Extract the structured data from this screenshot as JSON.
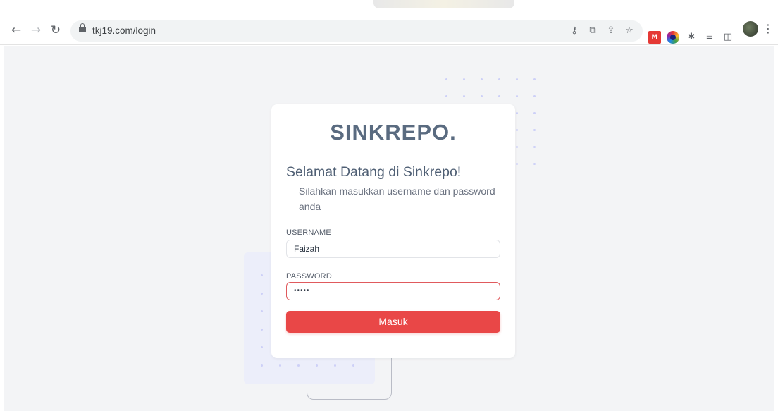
{
  "browser": {
    "url": "tkj19.com/login"
  },
  "login": {
    "brand": "SINKREPO.",
    "welcome": "Selamat Datang di Sinkrepo!",
    "subtitle": "Silahkan masukkan username dan password anda",
    "username_label": "USERNAME",
    "username_value": "Faizah",
    "password_label": "PASSWORD",
    "password_value": "•••••",
    "submit_label": "Masuk"
  },
  "colors": {
    "accent": "#e94747",
    "brand": "#5a6b80",
    "page_bg": "#f3f4f6"
  }
}
